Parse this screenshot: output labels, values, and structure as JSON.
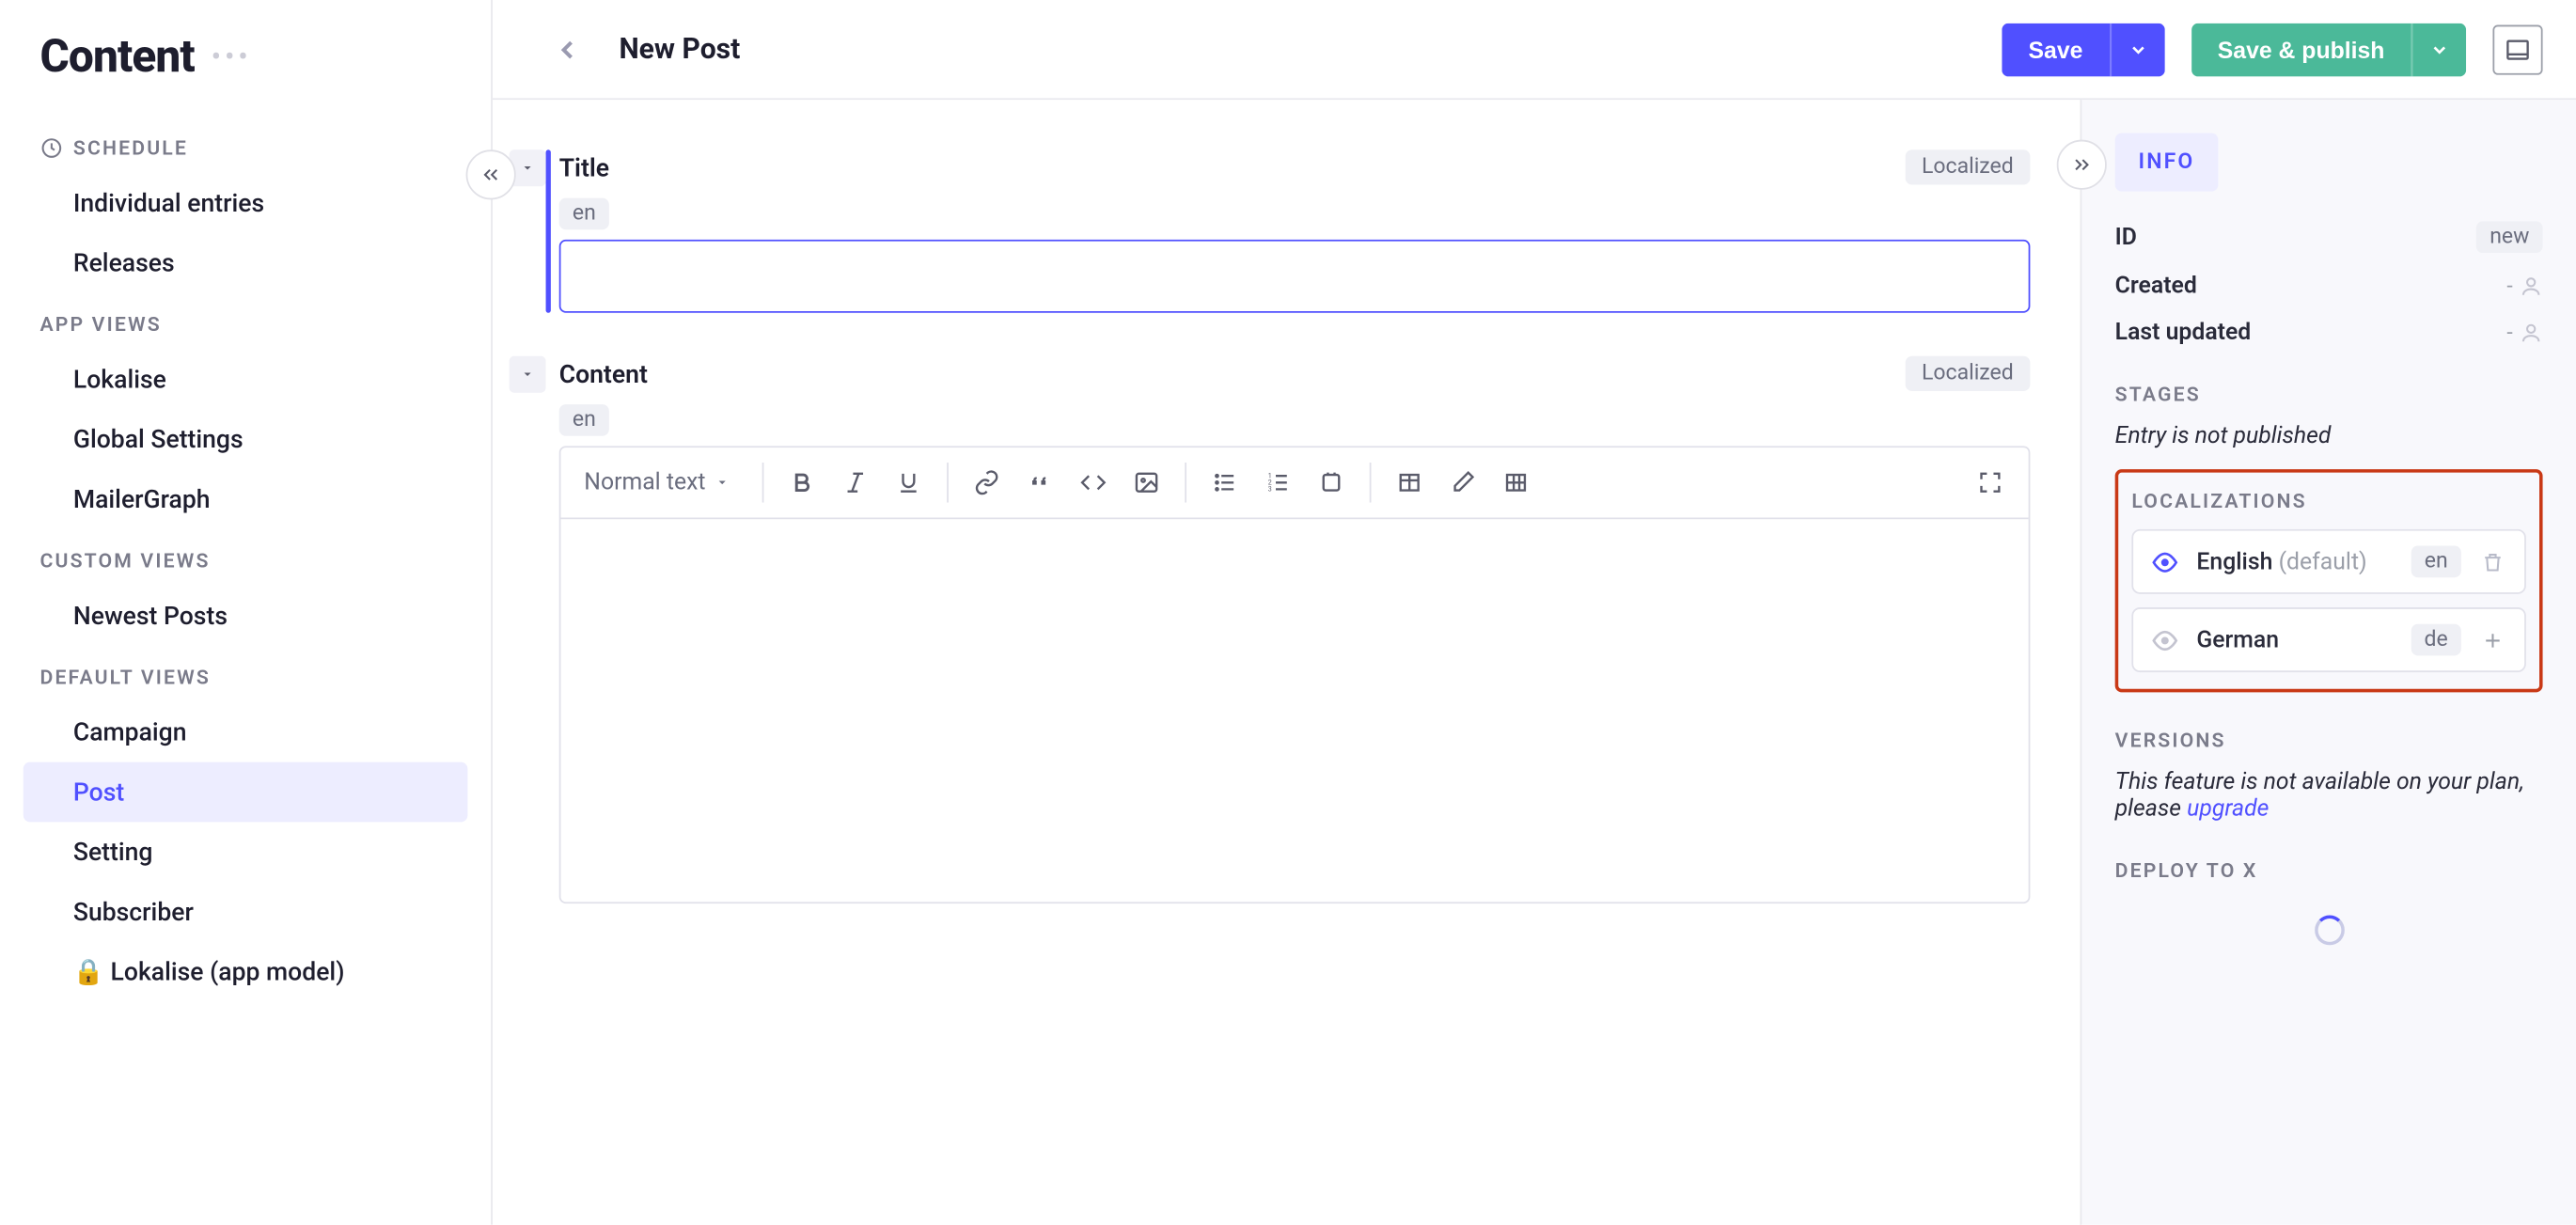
{
  "sidebar": {
    "title": "Content",
    "sections": {
      "schedule": {
        "label": "SCHEDULE",
        "items": [
          "Individual entries",
          "Releases"
        ]
      },
      "app_views": {
        "label": "APP VIEWS",
        "items": [
          "Lokalise",
          "Global Settings",
          "MailerGraph"
        ]
      },
      "custom_views": {
        "label": "CUSTOM VIEWS",
        "items": [
          "Newest Posts"
        ]
      },
      "default_views": {
        "label": "DEFAULT VIEWS",
        "items": [
          "Campaign",
          "Post",
          "Setting",
          "Subscriber",
          "🔒 Lokalise (app model)"
        ]
      }
    },
    "active_item": "Post"
  },
  "topbar": {
    "page_title": "New Post",
    "save_label": "Save",
    "publish_label": "Save & publish"
  },
  "fields": {
    "title": {
      "label": "Title",
      "badge": "Localized",
      "lang": "en",
      "value": ""
    },
    "content": {
      "label": "Content",
      "badge": "Localized",
      "lang": "en",
      "format_label": "Normal text"
    }
  },
  "info": {
    "tab_label": "INFO",
    "id": {
      "label": "ID",
      "value": "new"
    },
    "created": {
      "label": "Created",
      "value": "-"
    },
    "updated": {
      "label": "Last updated",
      "value": "-"
    },
    "stages": {
      "label": "STAGES",
      "note": "Entry is not published"
    },
    "localizations": {
      "label": "LOCALIZATIONS",
      "items": [
        {
          "name": "English",
          "default_suffix": "(default)",
          "code": "en",
          "active": true,
          "action": "delete"
        },
        {
          "name": "German",
          "default_suffix": "",
          "code": "de",
          "active": false,
          "action": "add"
        }
      ]
    },
    "versions": {
      "label": "VERSIONS",
      "note_prefix": "This feature is not available on your plan, please ",
      "link": "upgrade"
    },
    "deploy": {
      "label": "DEPLOY TO X"
    }
  }
}
